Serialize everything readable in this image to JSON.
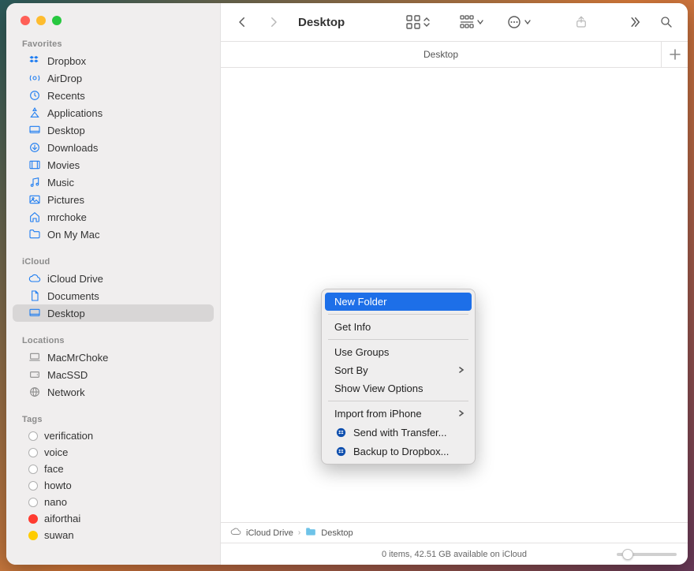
{
  "window_title": "Desktop",
  "tab_label": "Desktop",
  "sidebar": {
    "favorites_label": "Favorites",
    "favorites": [
      {
        "label": "Dropbox",
        "icon": "dropbox"
      },
      {
        "label": "AirDrop",
        "icon": "airdrop"
      },
      {
        "label": "Recents",
        "icon": "clock"
      },
      {
        "label": "Applications",
        "icon": "apps"
      },
      {
        "label": "Desktop",
        "icon": "desktop"
      },
      {
        "label": "Downloads",
        "icon": "download"
      },
      {
        "label": "Movies",
        "icon": "movie"
      },
      {
        "label": "Music",
        "icon": "music"
      },
      {
        "label": "Pictures",
        "icon": "pictures"
      },
      {
        "label": "mrchoke",
        "icon": "home"
      },
      {
        "label": "On My Mac",
        "icon": "folder"
      }
    ],
    "icloud_label": "iCloud",
    "icloud": [
      {
        "label": "iCloud Drive",
        "icon": "cloud"
      },
      {
        "label": "Documents",
        "icon": "doc"
      },
      {
        "label": "Desktop",
        "icon": "desktop",
        "selected": true
      }
    ],
    "locations_label": "Locations",
    "locations": [
      {
        "label": "MacMrChoke",
        "icon": "laptop"
      },
      {
        "label": "MacSSD",
        "icon": "disk"
      },
      {
        "label": "Network",
        "icon": "globe"
      }
    ],
    "tags_label": "Tags",
    "tags": [
      {
        "label": "verification",
        "color": ""
      },
      {
        "label": "voice",
        "color": ""
      },
      {
        "label": "face",
        "color": ""
      },
      {
        "label": "howto",
        "color": ""
      },
      {
        "label": "nano",
        "color": ""
      },
      {
        "label": "aiforthai",
        "color": "#ff3b30"
      },
      {
        "label": "suwan",
        "color": "#ffcc00"
      }
    ]
  },
  "context_menu": {
    "items": [
      {
        "label": "New Folder",
        "hl": true
      },
      {
        "sep": true
      },
      {
        "label": "Get Info"
      },
      {
        "sep": true
      },
      {
        "label": "Use Groups"
      },
      {
        "label": "Sort By",
        "submenu": true
      },
      {
        "label": "Show View Options"
      },
      {
        "sep": true
      },
      {
        "label": "Import from iPhone",
        "submenu": true
      },
      {
        "label": "Send with Transfer...",
        "icon": "dropbox-round"
      },
      {
        "label": "Backup to Dropbox...",
        "icon": "dropbox-round"
      }
    ]
  },
  "pathbar": {
    "icloud": "iCloud Drive",
    "desktop": "Desktop"
  },
  "statusbar": "0 items, 42.51 GB available on iCloud"
}
